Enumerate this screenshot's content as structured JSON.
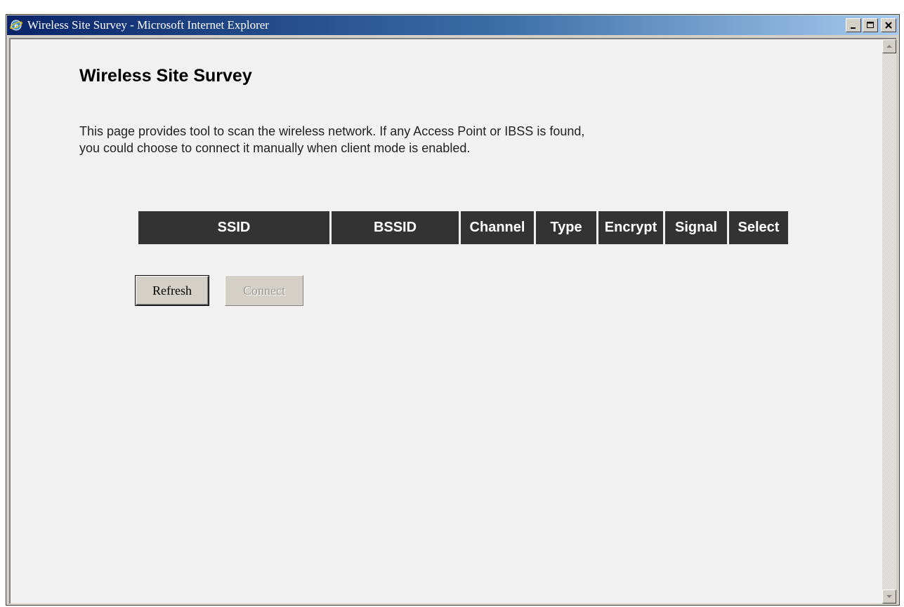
{
  "window": {
    "title": "Wireless Site Survey - Microsoft Internet Explorer",
    "controls": [
      "minimize",
      "maximize",
      "close"
    ]
  },
  "page": {
    "title": "Wireless Site Survey",
    "description_line1": "This page provides tool to scan the wireless network. If any Access Point or IBSS is found,",
    "description_line2": "you could choose to connect it manually when client mode is enabled."
  },
  "table": {
    "headers": [
      "SSID",
      "BSSID",
      "Channel",
      "Type",
      "Encrypt",
      "Signal",
      "Select"
    ],
    "rows": []
  },
  "buttons": {
    "refresh_label": "Refresh",
    "connect_label": "Connect",
    "connect_disabled": true
  },
  "icons": {
    "app": "ie-icon",
    "minimize": "minimize-icon",
    "maximize": "maximize-icon",
    "close": "close-icon",
    "scroll_up": "arrow-up-icon",
    "scroll_down": "arrow-down-icon"
  },
  "colors": {
    "titlebar_start": "#0a246a",
    "titlebar_end": "#a6caf0",
    "header_bg": "#333333",
    "header_text": "#ffffff",
    "page_bg": "#f1f1f1"
  }
}
